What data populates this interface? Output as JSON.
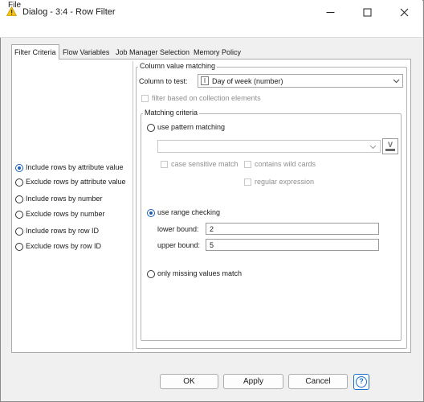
{
  "window": {
    "title": "Dialog - 3:4 - Row Filter"
  },
  "menu": {
    "file": "File"
  },
  "tabs": [
    {
      "label": "Filter Criteria",
      "active": true
    },
    {
      "label": "Flow Variables",
      "active": false
    },
    {
      "label": "Job Manager Selection",
      "active": false
    },
    {
      "label": "Memory Policy",
      "active": false
    }
  ],
  "left_options": [
    {
      "label": "Include rows by attribute value",
      "selected": true
    },
    {
      "label": "Exclude rows by attribute value",
      "selected": false
    },
    {
      "label": "Include rows by number",
      "selected": false
    },
    {
      "label": "Exclude rows by number",
      "selected": false
    },
    {
      "label": "Include rows by row ID",
      "selected": false
    },
    {
      "label": "Exclude rows by row ID",
      "selected": false
    }
  ],
  "column_matching": {
    "legend": "Column value matching",
    "column_label": "Column to test:",
    "column_type_glyph": "I",
    "column_value": "Day of week (number)",
    "collection_checkbox": "filter based on collection elements"
  },
  "matching_criteria": {
    "legend": "Matching criteria",
    "pattern_radio": "use pattern matching",
    "pattern_value": "",
    "var_button_glyph": "V",
    "case_sensitive": "case sensitive match",
    "wild_cards": "contains wild cards",
    "regex": "regular expression",
    "range_radio": "use range checking",
    "lower_label": "lower bound:",
    "lower_value": "2",
    "upper_label": "upper bound:",
    "upper_value": "5",
    "missing_radio": "only missing values match"
  },
  "buttons": {
    "ok": "OK",
    "apply": "Apply",
    "cancel": "Cancel",
    "help": "?"
  },
  "colors": {
    "accent": "#1a5fb4",
    "warning_icon": "#f5c211"
  }
}
